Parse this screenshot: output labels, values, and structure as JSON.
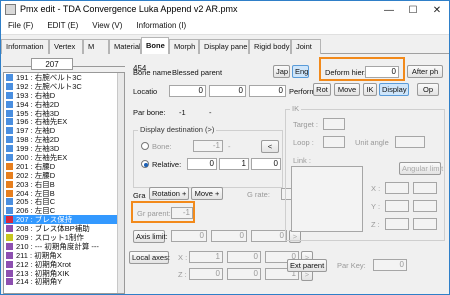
{
  "window": {
    "title": "Pmx edit - TDA Convergence Luka Append v2 AR.pmx"
  },
  "menu": [
    "File (F)",
    "EDIT (E)",
    "View (V)",
    "Information (I)"
  ],
  "tabs": [
    "Information",
    "Vertex",
    "M",
    "Material",
    "Bone",
    "Morph",
    "Display pane",
    "Rigid body",
    "Joint"
  ],
  "left": {
    "count_value": "207",
    "items": [
      {
        "label": "191 : 右腕ベルト3C",
        "color": "#4a8fe0"
      },
      {
        "label": "192 : 左腕ベルト3C",
        "color": "#4a8fe0"
      },
      {
        "label": "193 : 右袖D",
        "color": "#4a8fe0"
      },
      {
        "label": "194 : 右袖2D",
        "color": "#4a8fe0"
      },
      {
        "label": "195 : 右袖3D",
        "color": "#4a8fe0"
      },
      {
        "label": "196 : 右袖先EX",
        "color": "#4a8fe0"
      },
      {
        "label": "197 : 左袖D",
        "color": "#4a8fe0"
      },
      {
        "label": "198 : 左袖2D",
        "color": "#4a8fe0"
      },
      {
        "label": "199 : 左袖3D",
        "color": "#4a8fe0"
      },
      {
        "label": "200 : 左袖先EX",
        "color": "#4a8fe0"
      },
      {
        "label": "201 : 右腰D",
        "color": "#e77f1e"
      },
      {
        "label": "202 : 左腰D",
        "color": "#e77f1e"
      },
      {
        "label": "203 : 右目B",
        "color": "#e77f1e"
      },
      {
        "label": "204 : 左目B",
        "color": "#e77f1e"
      },
      {
        "label": "205 : 右目C",
        "color": "#4a8fe0"
      },
      {
        "label": "206 : 左目C",
        "color": "#4a8fe0"
      },
      {
        "label": "207 : ブレス保持",
        "color": "#d7263d",
        "selected": true
      },
      {
        "label": "208 : ブレス体BP補助",
        "color": "#8d4fb0"
      },
      {
        "label": "209 : スロット1制作",
        "color": "#c7c71e"
      },
      {
        "label": "210 : --- 初期角度計算 ---",
        "color": "#8d4fb0"
      },
      {
        "label": "211 : 初期角X",
        "color": "#8d4fb0"
      },
      {
        "label": "212 : 初期角Xrot",
        "color": "#8d4fb0"
      },
      {
        "label": "213 : 初期角XIK",
        "color": "#8d4fb0"
      },
      {
        "label": "214 : 初期角Y",
        "color": "#8d4fb0"
      }
    ]
  },
  "bone": {
    "count": "454",
    "name_label": "Bone name",
    "name_value": "Blessed parent",
    "jp_button": "Jap",
    "en_button": "Eng",
    "location_label": "Locatio",
    "location": [
      "0",
      "0",
      "0"
    ],
    "parent_bone_label": "Par bone:",
    "parent_bone_value": "-1",
    "dash": "-",
    "display_dest_title": "Display destination (>)",
    "dest_bone_label": "Bone:",
    "dest_bone_value": "-1",
    "dest_bone_button": "<",
    "dest_relative_label": "Relative:",
    "dest_relative": [
      "0",
      "1",
      "0"
    ],
    "grant_label": "Gra",
    "rotation_button": "Rotation +",
    "move_button": "Move +",
    "grate_label": "G rate:",
    "grate_value": "1",
    "grant_parent_label": "Gr parent:",
    "grant_parent_value": "-1",
    "axis_limit_button": "Axis limit:",
    "axis_limit": [
      "0",
      "0",
      "0"
    ],
    "axis_limit_arrow": ">",
    "local_axes_button": "Local axes:",
    "local_x_label": "X :",
    "local_x": [
      "1",
      "0",
      "0"
    ],
    "local_z_label": "Z :",
    "local_z": [
      "0",
      "0",
      "1"
    ],
    "local_arrow": ">",
    "performance_label": "Performa",
    "deform_hier_label": "Deform hier:",
    "deform_hier_value": "0",
    "after_phys_button": "After ph",
    "rot_button": "Rot",
    "move_toggle": "Move",
    "ik_button": "IK",
    "display_button": "Display",
    "op_button": "Op",
    "ik_title": "IK",
    "target_label": "Target :",
    "loop_label": "Loop :",
    "unit_angle_label": "Unit angle",
    "link_label": "Link :",
    "angular_limit_button": "Angular limit",
    "ik_x": "X :",
    "ik_y": "Y :",
    "ik_z": "Z :",
    "ext_parent_button": "Ext parent",
    "par_key_label": "Par Key:",
    "par_key_value": "0"
  },
  "colors": {
    "highlight": "#f28a1b",
    "selection": "#3399ff"
  }
}
